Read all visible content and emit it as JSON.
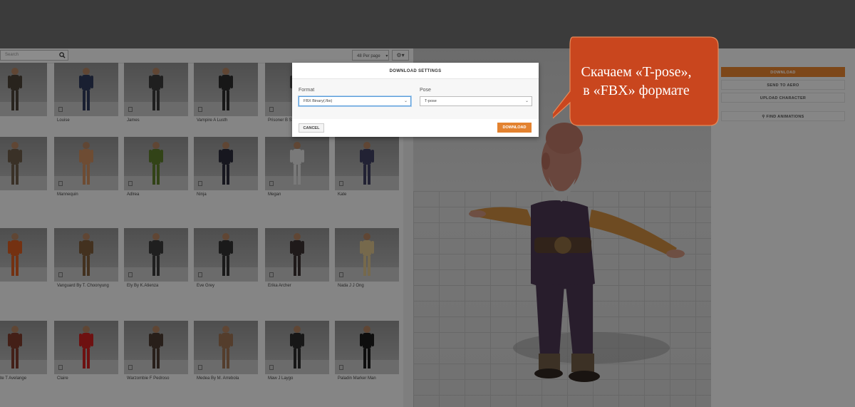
{
  "toolbar": {
    "search_placeholder": "Search",
    "per_page": "48 Per page",
    "per_page_chevron": "▾",
    "settings_chevron": "▾"
  },
  "characters": [
    {
      "name": "",
      "figure": "#4a4036"
    },
    {
      "name": "Louise",
      "figure": "#2f3a5a"
    },
    {
      "name": "James",
      "figure": "#3a3a3a"
    },
    {
      "name": "Vampire A Lusth",
      "figure": "#2a2a2a"
    },
    {
      "name": "Prisoner B St",
      "figure": "#4a4a4a"
    },
    {
      "name": "",
      "figure": "#6b5a48"
    },
    {
      "name": "Mannequin",
      "figure": "#c98a5e"
    },
    {
      "name": "Adlrea",
      "figure": "#5c7a2a"
    },
    {
      "name": "Ninja",
      "figure": "#2a2a3a"
    },
    {
      "name": "Megan",
      "figure": "#dcdcdc"
    },
    {
      "name": "Kate",
      "figure": "#3f3f5f"
    },
    {
      "name": "",
      "figure": "#d35a20"
    },
    {
      "name": "Vanguard By T. Choonyung",
      "figure": "#7a5a3a"
    },
    {
      "name": "Ely By K.Atienza",
      "figure": "#3a3a3a"
    },
    {
      "name": "Eve Grey",
      "figure": "#303030"
    },
    {
      "name": "Erika Archer",
      "figure": "#3a3030"
    },
    {
      "name": "Nada J J Ong",
      "figure": "#d7c08a"
    },
    {
      "name": "Mausolite T Avelange",
      "figure": "#7a3a2a"
    },
    {
      "name": "Claire",
      "figure": "#c82020"
    },
    {
      "name": "Warzombie F Pedroso",
      "figure": "#4a3a30"
    },
    {
      "name": "Medea By M. Arrebola",
      "figure": "#9a7050"
    },
    {
      "name": "Maw J Laygo",
      "figure": "#2a2a2a"
    },
    {
      "name": "Paladin Marker Man",
      "figure": "#1a1a1a"
    }
  ],
  "viewer": {
    "model": "t-pose-old-monk"
  },
  "right_panel": {
    "download": "DOWNLOAD",
    "send_to_aero": "SEND TO AERO",
    "upload_character": "UPLOAD CHARACTER",
    "find_animations": "FIND ANIMATIONS"
  },
  "modal": {
    "title": "DOWNLOAD SETTINGS",
    "format_label": "Format",
    "format_value": "FBX Binary(.fbx)",
    "pose_label": "Pose",
    "pose_value": "T-pose",
    "cancel": "CANCEL",
    "download": "DOWNLOAD"
  },
  "callout": {
    "line1": "Скачаем «T-pose»,",
    "line2": "в «FBX» формате",
    "color": "#c9461e"
  },
  "colors": {
    "accent": "#e3822f",
    "topbar": "#3b3b3b"
  }
}
